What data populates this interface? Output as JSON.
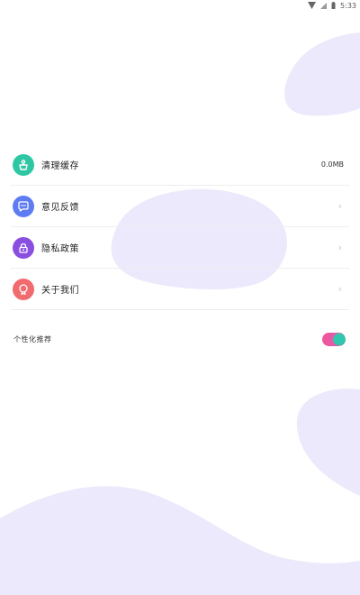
{
  "status_bar": {
    "time": "5:33",
    "icons": [
      "signal-icon",
      "wifi-icon",
      "battery-icon"
    ]
  },
  "menu": {
    "items": [
      {
        "label": "清理缓存",
        "value": "0.0MB",
        "icon": "broom-icon",
        "color": "#2ec7a3"
      },
      {
        "label": "意见反馈",
        "value": "",
        "icon": "chat-bubble-icon",
        "color": "#5e7cf2"
      },
      {
        "label": "隐私政策",
        "value": "",
        "icon": "lock-icon",
        "color": "#8b4fe0"
      },
      {
        "label": "关于我们",
        "value": "",
        "icon": "info-badge-icon",
        "color": "#f06a6e"
      }
    ]
  },
  "personalize": {
    "label": "个性化推荐",
    "enabled": true
  },
  "colors": {
    "accent_pink": "#f0559a",
    "accent_teal": "#2fc7ad",
    "blob": "#ebe9fb"
  }
}
